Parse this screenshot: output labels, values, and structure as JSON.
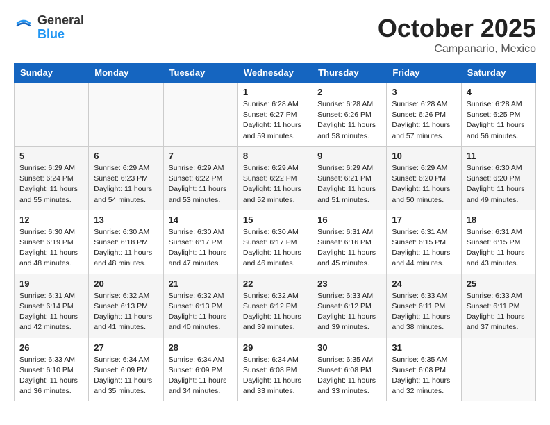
{
  "header": {
    "logo_general": "General",
    "logo_blue": "Blue",
    "month": "October 2025",
    "location": "Campanario, Mexico"
  },
  "weekdays": [
    "Sunday",
    "Monday",
    "Tuesday",
    "Wednesday",
    "Thursday",
    "Friday",
    "Saturday"
  ],
  "weeks": [
    [
      {
        "day": "",
        "info": ""
      },
      {
        "day": "",
        "info": ""
      },
      {
        "day": "",
        "info": ""
      },
      {
        "day": "1",
        "info": "Sunrise: 6:28 AM\nSunset: 6:27 PM\nDaylight: 11 hours\nand 59 minutes."
      },
      {
        "day": "2",
        "info": "Sunrise: 6:28 AM\nSunset: 6:26 PM\nDaylight: 11 hours\nand 58 minutes."
      },
      {
        "day": "3",
        "info": "Sunrise: 6:28 AM\nSunset: 6:26 PM\nDaylight: 11 hours\nand 57 minutes."
      },
      {
        "day": "4",
        "info": "Sunrise: 6:28 AM\nSunset: 6:25 PM\nDaylight: 11 hours\nand 56 minutes."
      }
    ],
    [
      {
        "day": "5",
        "info": "Sunrise: 6:29 AM\nSunset: 6:24 PM\nDaylight: 11 hours\nand 55 minutes."
      },
      {
        "day": "6",
        "info": "Sunrise: 6:29 AM\nSunset: 6:23 PM\nDaylight: 11 hours\nand 54 minutes."
      },
      {
        "day": "7",
        "info": "Sunrise: 6:29 AM\nSunset: 6:22 PM\nDaylight: 11 hours\nand 53 minutes."
      },
      {
        "day": "8",
        "info": "Sunrise: 6:29 AM\nSunset: 6:22 PM\nDaylight: 11 hours\nand 52 minutes."
      },
      {
        "day": "9",
        "info": "Sunrise: 6:29 AM\nSunset: 6:21 PM\nDaylight: 11 hours\nand 51 minutes."
      },
      {
        "day": "10",
        "info": "Sunrise: 6:29 AM\nSunset: 6:20 PM\nDaylight: 11 hours\nand 50 minutes."
      },
      {
        "day": "11",
        "info": "Sunrise: 6:30 AM\nSunset: 6:20 PM\nDaylight: 11 hours\nand 49 minutes."
      }
    ],
    [
      {
        "day": "12",
        "info": "Sunrise: 6:30 AM\nSunset: 6:19 PM\nDaylight: 11 hours\nand 48 minutes."
      },
      {
        "day": "13",
        "info": "Sunrise: 6:30 AM\nSunset: 6:18 PM\nDaylight: 11 hours\nand 48 minutes."
      },
      {
        "day": "14",
        "info": "Sunrise: 6:30 AM\nSunset: 6:17 PM\nDaylight: 11 hours\nand 47 minutes."
      },
      {
        "day": "15",
        "info": "Sunrise: 6:30 AM\nSunset: 6:17 PM\nDaylight: 11 hours\nand 46 minutes."
      },
      {
        "day": "16",
        "info": "Sunrise: 6:31 AM\nSunset: 6:16 PM\nDaylight: 11 hours\nand 45 minutes."
      },
      {
        "day": "17",
        "info": "Sunrise: 6:31 AM\nSunset: 6:15 PM\nDaylight: 11 hours\nand 44 minutes."
      },
      {
        "day": "18",
        "info": "Sunrise: 6:31 AM\nSunset: 6:15 PM\nDaylight: 11 hours\nand 43 minutes."
      }
    ],
    [
      {
        "day": "19",
        "info": "Sunrise: 6:31 AM\nSunset: 6:14 PM\nDaylight: 11 hours\nand 42 minutes."
      },
      {
        "day": "20",
        "info": "Sunrise: 6:32 AM\nSunset: 6:13 PM\nDaylight: 11 hours\nand 41 minutes."
      },
      {
        "day": "21",
        "info": "Sunrise: 6:32 AM\nSunset: 6:13 PM\nDaylight: 11 hours\nand 40 minutes."
      },
      {
        "day": "22",
        "info": "Sunrise: 6:32 AM\nSunset: 6:12 PM\nDaylight: 11 hours\nand 39 minutes."
      },
      {
        "day": "23",
        "info": "Sunrise: 6:33 AM\nSunset: 6:12 PM\nDaylight: 11 hours\nand 39 minutes."
      },
      {
        "day": "24",
        "info": "Sunrise: 6:33 AM\nSunset: 6:11 PM\nDaylight: 11 hours\nand 38 minutes."
      },
      {
        "day": "25",
        "info": "Sunrise: 6:33 AM\nSunset: 6:11 PM\nDaylight: 11 hours\nand 37 minutes."
      }
    ],
    [
      {
        "day": "26",
        "info": "Sunrise: 6:33 AM\nSunset: 6:10 PM\nDaylight: 11 hours\nand 36 minutes."
      },
      {
        "day": "27",
        "info": "Sunrise: 6:34 AM\nSunset: 6:09 PM\nDaylight: 11 hours\nand 35 minutes."
      },
      {
        "day": "28",
        "info": "Sunrise: 6:34 AM\nSunset: 6:09 PM\nDaylight: 11 hours\nand 34 minutes."
      },
      {
        "day": "29",
        "info": "Sunrise: 6:34 AM\nSunset: 6:08 PM\nDaylight: 11 hours\nand 33 minutes."
      },
      {
        "day": "30",
        "info": "Sunrise: 6:35 AM\nSunset: 6:08 PM\nDaylight: 11 hours\nand 33 minutes."
      },
      {
        "day": "31",
        "info": "Sunrise: 6:35 AM\nSunset: 6:08 PM\nDaylight: 11 hours\nand 32 minutes."
      },
      {
        "day": "",
        "info": ""
      }
    ]
  ]
}
